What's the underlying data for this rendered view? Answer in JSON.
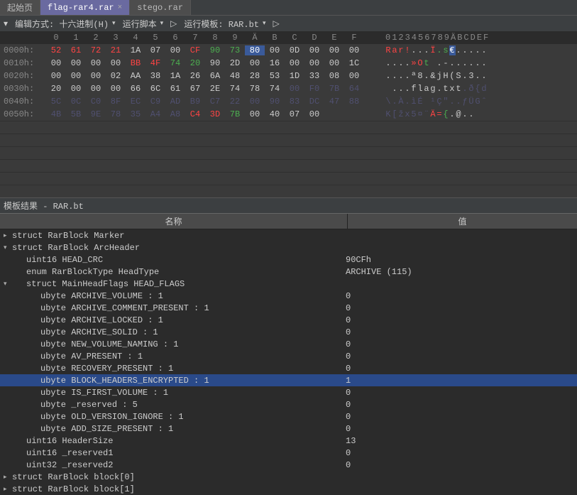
{
  "tabs": [
    {
      "label": "起始页",
      "active": false,
      "closable": false
    },
    {
      "label": "flag-rar4.rar",
      "active": true,
      "closable": true
    },
    {
      "label": "stego.rar",
      "active": false,
      "closable": false
    }
  ],
  "toolbar": {
    "arrow": "▾",
    "edit_label": "编辑方式: 十六进制(H)",
    "run_script": "运行脚本",
    "run_template": "运行模板: RAR.bt",
    "play": "▷"
  },
  "hex_header": {
    "cols": [
      "0",
      "1",
      "2",
      "3",
      "4",
      "5",
      "6",
      "7",
      "8",
      "9",
      "Ä",
      "B",
      "C",
      "D",
      "E",
      "F"
    ],
    "ascii": "0123456789ÄBCDEF"
  },
  "hex_rows": [
    {
      "addr": "0000h:",
      "bytes": [
        {
          "t": "52",
          "c": "c-red"
        },
        {
          "t": "61",
          "c": "c-red"
        },
        {
          "t": "72",
          "c": "c-red"
        },
        {
          "t": "21",
          "c": "c-red"
        },
        {
          "t": "1A",
          "c": ""
        },
        {
          "t": "07",
          "c": ""
        },
        {
          "t": "00",
          "c": ""
        },
        {
          "t": "CF",
          "c": "c-red"
        },
        {
          "t": "90",
          "c": "c-green"
        },
        {
          "t": "73",
          "c": "c-green"
        },
        {
          "t": "80",
          "c": "c-blue",
          "sel": true
        },
        {
          "t": "00",
          "c": ""
        },
        {
          "t": "0D",
          "c": ""
        },
        {
          "t": "00",
          "c": ""
        },
        {
          "t": "00",
          "c": ""
        },
        {
          "t": "00",
          "c": ""
        }
      ],
      "ascii": [
        {
          "t": "R",
          "c": "c-red"
        },
        {
          "t": "a",
          "c": "c-red"
        },
        {
          "t": "r",
          "c": "c-red"
        },
        {
          "t": "!",
          "c": "c-red"
        },
        {
          "t": ".",
          "c": ""
        },
        {
          "t": ".",
          "c": ""
        },
        {
          "t": ".",
          "c": ""
        },
        {
          "t": "Ï",
          "c": "c-red"
        },
        {
          "t": ".",
          "c": "c-green"
        },
        {
          "t": "s",
          "c": "c-green"
        },
        {
          "t": "€",
          "c": "c-blue",
          "sel": true
        },
        {
          "t": ".",
          "c": ""
        },
        {
          "t": ".",
          "c": ""
        },
        {
          "t": ".",
          "c": ""
        },
        {
          "t": ".",
          "c": ""
        },
        {
          "t": ".",
          "c": ""
        }
      ]
    },
    {
      "addr": "0010h:",
      "bytes": [
        {
          "t": "00",
          "c": ""
        },
        {
          "t": "00",
          "c": ""
        },
        {
          "t": "00",
          "c": ""
        },
        {
          "t": "00",
          "c": ""
        },
        {
          "t": "BB",
          "c": "c-red"
        },
        {
          "t": "4F",
          "c": "c-red"
        },
        {
          "t": "74",
          "c": "c-green"
        },
        {
          "t": "20",
          "c": "c-green"
        },
        {
          "t": "90",
          "c": ""
        },
        {
          "t": "2D",
          "c": ""
        },
        {
          "t": "00",
          "c": ""
        },
        {
          "t": "16",
          "c": ""
        },
        {
          "t": "00",
          "c": ""
        },
        {
          "t": "00",
          "c": ""
        },
        {
          "t": "00",
          "c": ""
        },
        {
          "t": "1C",
          "c": ""
        }
      ],
      "ascii": [
        {
          "t": ".",
          "c": ""
        },
        {
          "t": ".",
          "c": ""
        },
        {
          "t": ".",
          "c": ""
        },
        {
          "t": ".",
          "c": ""
        },
        {
          "t": "»",
          "c": "c-red"
        },
        {
          "t": "O",
          "c": "c-red"
        },
        {
          "t": "t",
          "c": "c-green"
        },
        {
          "t": " ",
          "c": "c-green"
        },
        {
          "t": ".",
          "c": ""
        },
        {
          "t": "-",
          "c": ""
        },
        {
          "t": ".",
          "c": ""
        },
        {
          "t": ".",
          "c": ""
        },
        {
          "t": ".",
          "c": ""
        },
        {
          "t": ".",
          "c": ""
        },
        {
          "t": ".",
          "c": ""
        },
        {
          "t": ".",
          "c": ""
        }
      ]
    },
    {
      "addr": "0020h:",
      "bytes": [
        {
          "t": "00",
          "c": ""
        },
        {
          "t": "00",
          "c": ""
        },
        {
          "t": "00",
          "c": ""
        },
        {
          "t": "02",
          "c": ""
        },
        {
          "t": "AA",
          "c": ""
        },
        {
          "t": "38",
          "c": ""
        },
        {
          "t": "1A",
          "c": ""
        },
        {
          "t": "26",
          "c": ""
        },
        {
          "t": "6A",
          "c": ""
        },
        {
          "t": "48",
          "c": ""
        },
        {
          "t": "28",
          "c": ""
        },
        {
          "t": "53",
          "c": ""
        },
        {
          "t": "1D",
          "c": ""
        },
        {
          "t": "33",
          "c": ""
        },
        {
          "t": "08",
          "c": ""
        },
        {
          "t": "00",
          "c": ""
        }
      ],
      "ascii": [
        {
          "t": ".",
          "c": ""
        },
        {
          "t": ".",
          "c": ""
        },
        {
          "t": ".",
          "c": ""
        },
        {
          "t": ".",
          "c": ""
        },
        {
          "t": "ª",
          "c": ""
        },
        {
          "t": "8",
          "c": ""
        },
        {
          "t": ".",
          "c": ""
        },
        {
          "t": "&",
          "c": ""
        },
        {
          "t": "j",
          "c": ""
        },
        {
          "t": "H",
          "c": ""
        },
        {
          "t": "(",
          "c": ""
        },
        {
          "t": "S",
          "c": ""
        },
        {
          "t": ".",
          "c": ""
        },
        {
          "t": "3",
          "c": ""
        },
        {
          "t": ".",
          "c": ""
        },
        {
          "t": ".",
          "c": ""
        }
      ]
    },
    {
      "addr": "0030h:",
      "bytes": [
        {
          "t": "20",
          "c": ""
        },
        {
          "t": "00",
          "c": ""
        },
        {
          "t": "00",
          "c": ""
        },
        {
          "t": "00",
          "c": ""
        },
        {
          "t": "66",
          "c": ""
        },
        {
          "t": "6C",
          "c": ""
        },
        {
          "t": "61",
          "c": ""
        },
        {
          "t": "67",
          "c": ""
        },
        {
          "t": "2E",
          "c": ""
        },
        {
          "t": "74",
          "c": ""
        },
        {
          "t": "78",
          "c": ""
        },
        {
          "t": "74",
          "c": ""
        },
        {
          "t": "00",
          "c": "c-dark"
        },
        {
          "t": "F0",
          "c": "c-dark"
        },
        {
          "t": "7B",
          "c": "c-dark"
        },
        {
          "t": "64",
          "c": "c-dark"
        }
      ],
      "ascii": [
        {
          "t": " ",
          "c": ""
        },
        {
          "t": ".",
          "c": ""
        },
        {
          "t": ".",
          "c": ""
        },
        {
          "t": ".",
          "c": ""
        },
        {
          "t": "f",
          "c": ""
        },
        {
          "t": "l",
          "c": ""
        },
        {
          "t": "a",
          "c": ""
        },
        {
          "t": "g",
          "c": ""
        },
        {
          "t": ".",
          "c": ""
        },
        {
          "t": "t",
          "c": ""
        },
        {
          "t": "x",
          "c": ""
        },
        {
          "t": "t",
          "c": ""
        },
        {
          "t": ".",
          "c": "c-dark"
        },
        {
          "t": "ð",
          "c": "c-dark"
        },
        {
          "t": "{",
          "c": "c-dark"
        },
        {
          "t": "d",
          "c": "c-dark"
        }
      ]
    },
    {
      "addr": "0040h:",
      "bytes": [
        {
          "t": "5C",
          "c": "c-dark"
        },
        {
          "t": "0C",
          "c": "c-dark"
        },
        {
          "t": "C0",
          "c": "c-dark"
        },
        {
          "t": "8F",
          "c": "c-dark"
        },
        {
          "t": "EC",
          "c": "c-dark"
        },
        {
          "t": "C9",
          "c": "c-dark"
        },
        {
          "t": "AD",
          "c": "c-dark"
        },
        {
          "t": "B9",
          "c": "c-dark"
        },
        {
          "t": "C7",
          "c": "c-dark"
        },
        {
          "t": "22",
          "c": "c-dark"
        },
        {
          "t": "00",
          "c": "c-dark"
        },
        {
          "t": "90",
          "c": "c-dark"
        },
        {
          "t": "83",
          "c": "c-dark"
        },
        {
          "t": "DC",
          "c": "c-dark"
        },
        {
          "t": "47",
          "c": "c-dark"
        },
        {
          "t": "88",
          "c": "c-dark"
        }
      ],
      "ascii": [
        {
          "t": "\\",
          "c": "c-dark"
        },
        {
          "t": ".",
          "c": "c-dark"
        },
        {
          "t": "À",
          "c": "c-dark"
        },
        {
          "t": ".",
          "c": "c-dark"
        },
        {
          "t": "ì",
          "c": "c-dark"
        },
        {
          "t": "É",
          "c": "c-dark"
        },
        {
          "t": "­",
          "c": "c-dark"
        },
        {
          "t": "¹",
          "c": "c-dark"
        },
        {
          "t": "Ç",
          "c": "c-dark"
        },
        {
          "t": "\"",
          "c": "c-dark"
        },
        {
          "t": ".",
          "c": "c-dark"
        },
        {
          "t": ".",
          "c": "c-dark"
        },
        {
          "t": "ƒ",
          "c": "c-dark"
        },
        {
          "t": "Ü",
          "c": "c-dark"
        },
        {
          "t": "G",
          "c": "c-dark"
        },
        {
          "t": "ˆ",
          "c": "c-dark"
        }
      ]
    },
    {
      "addr": "0050h:",
      "bytes": [
        {
          "t": "4B",
          "c": "c-dark"
        },
        {
          "t": "5B",
          "c": "c-dark"
        },
        {
          "t": "9E",
          "c": "c-dark"
        },
        {
          "t": "78",
          "c": "c-dark"
        },
        {
          "t": "35",
          "c": "c-dark"
        },
        {
          "t": "A4",
          "c": "c-dark"
        },
        {
          "t": "A8",
          "c": "c-dark"
        },
        {
          "t": "C4",
          "c": "c-red"
        },
        {
          "t": "3D",
          "c": "c-red"
        },
        {
          "t": "7B",
          "c": "c-green"
        },
        {
          "t": "00",
          "c": ""
        },
        {
          "t": "40",
          "c": ""
        },
        {
          "t": "07",
          "c": ""
        },
        {
          "t": "00",
          "c": ""
        },
        {
          "t": "",
          "c": ""
        },
        {
          "t": "",
          "c": ""
        }
      ],
      "ascii": [
        {
          "t": "K",
          "c": "c-dark"
        },
        {
          "t": "[",
          "c": "c-dark"
        },
        {
          "t": "ž",
          "c": "c-dark"
        },
        {
          "t": "x",
          "c": "c-dark"
        },
        {
          "t": "5",
          "c": "c-dark"
        },
        {
          "t": "¤",
          "c": "c-dark"
        },
        {
          "t": "¨",
          "c": "c-dark"
        },
        {
          "t": "Ä",
          "c": "c-red"
        },
        {
          "t": "=",
          "c": "c-red"
        },
        {
          "t": "{",
          "c": "c-green"
        },
        {
          "t": ".",
          "c": ""
        },
        {
          "t": "@",
          "c": ""
        },
        {
          "t": ".",
          "c": ""
        },
        {
          "t": ".",
          "c": ""
        },
        {
          "t": "",
          "c": ""
        },
        {
          "t": "",
          "c": ""
        }
      ]
    }
  ],
  "template_header": "模板结果 - RAR.bt",
  "grid_cols": {
    "name": "名称",
    "value": "值"
  },
  "tree": [
    {
      "ind": 0,
      "arrow": "▸",
      "name": "struct RarBlock Marker",
      "val": ""
    },
    {
      "ind": 0,
      "arrow": "▾",
      "name": "struct RarBlock ArcHeader",
      "val": ""
    },
    {
      "ind": 1,
      "arrow": "",
      "name": "uint16 HEAD_CRC",
      "val": "90CFh"
    },
    {
      "ind": 1,
      "arrow": "",
      "name": "enum RarBlockType HeadType",
      "val": "ARCHIVE (115)"
    },
    {
      "ind": 1,
      "arrow": "▾",
      "name": "struct MainHeadFlags HEAD_FLAGS",
      "val": ""
    },
    {
      "ind": 2,
      "arrow": "",
      "name": "ubyte ARCHIVE_VOLUME : 1",
      "val": "0"
    },
    {
      "ind": 2,
      "arrow": "",
      "name": "ubyte ARCHIVE_COMMENT_PRESENT : 1",
      "val": "0"
    },
    {
      "ind": 2,
      "arrow": "",
      "name": "ubyte ARCHIVE_LOCKED : 1",
      "val": "0"
    },
    {
      "ind": 2,
      "arrow": "",
      "name": "ubyte ARCHIVE_SOLID : 1",
      "val": "0"
    },
    {
      "ind": 2,
      "arrow": "",
      "name": "ubyte NEW_VOLUME_NAMING : 1",
      "val": "0"
    },
    {
      "ind": 2,
      "arrow": "",
      "name": "ubyte AV_PRESENT : 1",
      "val": "0"
    },
    {
      "ind": 2,
      "arrow": "",
      "name": "ubyte RECOVERY_PRESENT : 1",
      "val": "0"
    },
    {
      "ind": 2,
      "arrow": "",
      "name": "ubyte BLOCK_HEADERS_ENCRYPTED : 1",
      "val": "1",
      "sel": true
    },
    {
      "ind": 2,
      "arrow": "",
      "name": "ubyte IS_FIRST_VOLUME : 1",
      "val": "0"
    },
    {
      "ind": 2,
      "arrow": "",
      "name": "ubyte _reserved : 5",
      "val": "0"
    },
    {
      "ind": 2,
      "arrow": "",
      "name": "ubyte OLD_VERSION_IGNORE : 1",
      "val": "0"
    },
    {
      "ind": 2,
      "arrow": "",
      "name": "ubyte ADD_SIZE_PRESENT : 1",
      "val": "0"
    },
    {
      "ind": 1,
      "arrow": "",
      "name": "uint16 HeaderSize",
      "val": "13"
    },
    {
      "ind": 1,
      "arrow": "",
      "name": "uint16 _reserved1",
      "val": "0"
    },
    {
      "ind": 1,
      "arrow": "",
      "name": "uint32 _reserved2",
      "val": "0"
    },
    {
      "ind": 0,
      "arrow": "▸",
      "name": "struct RarBlock block[0]",
      "val": ""
    },
    {
      "ind": 0,
      "arrow": "▸",
      "name": "struct RarBlock block[1]",
      "val": ""
    }
  ]
}
